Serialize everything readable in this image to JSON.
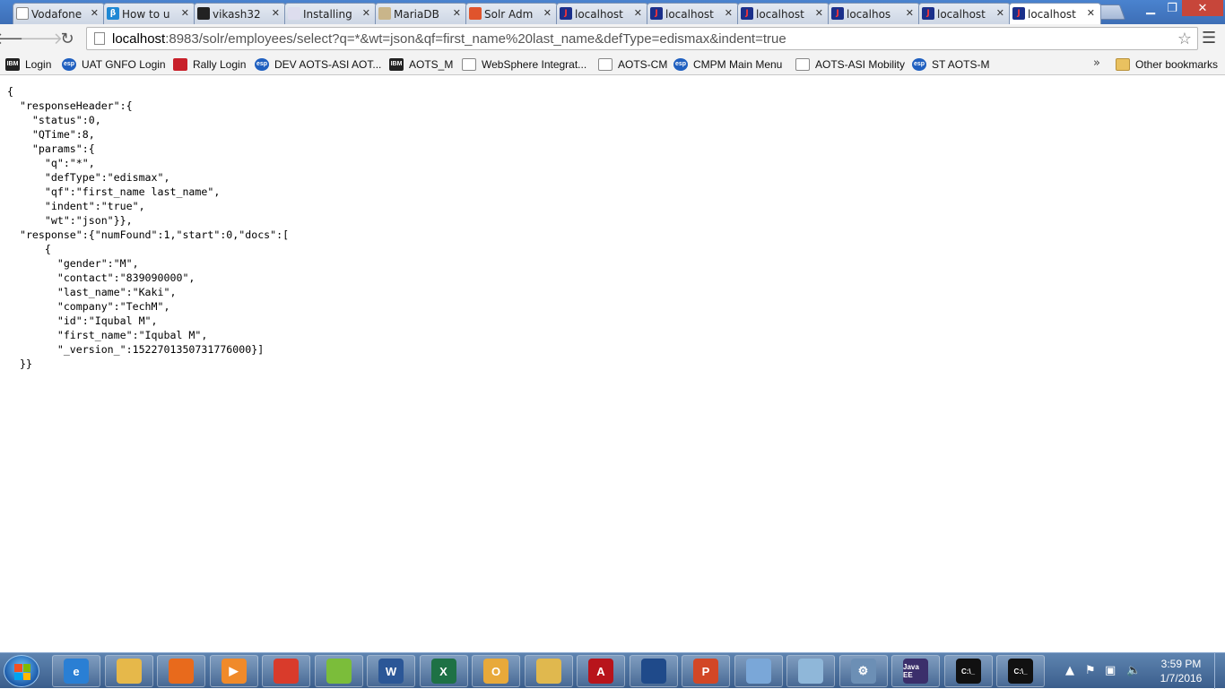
{
  "tabs": [
    {
      "title": "Vodafone",
      "icon": "document-icon"
    },
    {
      "title": "How to u",
      "icon": "blue-b-icon"
    },
    {
      "title": "vikash32",
      "icon": "github-icon"
    },
    {
      "title": "Installing",
      "icon": "installing-icon"
    },
    {
      "title": "MariaDB",
      "icon": "mariadb-icon"
    },
    {
      "title": "Solr Adm",
      "icon": "solr-icon"
    },
    {
      "title": "localhost",
      "icon": "jr-icon"
    },
    {
      "title": "localhost",
      "icon": "jr-icon"
    },
    {
      "title": "localhost",
      "icon": "jr-icon"
    },
    {
      "title": "localhos",
      "icon": "jr-icon"
    },
    {
      "title": "localhost",
      "icon": "jr-icon"
    },
    {
      "title": "localhost",
      "icon": "jr-icon",
      "active": true
    }
  ],
  "address_bar": {
    "host": "localhost",
    "rest": ":8983/solr/employees/select?q=*&wt=json&qf=first_name%20last_name&defType=edismax&indent=true"
  },
  "bookmarks": [
    {
      "label": "Login",
      "icon": "ibm"
    },
    {
      "label": "UAT GNFO Login",
      "icon": "esp"
    },
    {
      "label": "Rally Login",
      "icon": "rally"
    },
    {
      "label": "DEV AOTS-ASI AOT...",
      "icon": "esp"
    },
    {
      "label": "AOTS_M",
      "icon": "ibm"
    },
    {
      "label": "WebSphere Integrat...",
      "icon": "doc"
    },
    {
      "label": "AOTS-CM",
      "icon": "doc"
    },
    {
      "label": "CMPM Main Menu",
      "icon": "esp"
    },
    {
      "label": "AOTS-ASI Mobility",
      "icon": "doc"
    },
    {
      "label": "ST AOTS-M",
      "icon": "esp"
    }
  ],
  "other_bookmarks": "Other bookmarks",
  "json_lines": [
    "{",
    "  \"responseHeader\":{",
    "    \"status\":0,",
    "    \"QTime\":8,",
    "    \"params\":{",
    "      \"q\":\"*\",",
    "      \"defType\":\"edismax\",",
    "      \"qf\":\"first_name last_name\",",
    "      \"indent\":\"true\",",
    "      \"wt\":\"json\"}},",
    "  \"response\":{\"numFound\":1,\"start\":0,\"docs\":[",
    "      {",
    "        \"gender\":\"M\",",
    "        \"contact\":\"839090000\",",
    "        \"last_name\":\"Kaki\",",
    "        \"company\":\"TechM\",",
    "        \"id\":\"Iqubal M\",",
    "        \"first_name\":\"Iqubal M\",",
    "        \"_version_\":1522701350731776000}]",
    "  }}"
  ],
  "taskbar": {
    "apps": [
      {
        "name": "internet-explorer-icon",
        "color": "#2a7fd4",
        "glyph": "e"
      },
      {
        "name": "file-explorer-icon",
        "color": "#e6b84a",
        "glyph": ""
      },
      {
        "name": "firefox-icon",
        "color": "#e86a1c",
        "glyph": ""
      },
      {
        "name": "media-player-icon",
        "color": "#f08a2a",
        "glyph": "▶"
      },
      {
        "name": "chrome-icon",
        "color": "#d93b2b",
        "glyph": ""
      },
      {
        "name": "notepad-plus-icon",
        "color": "#7bbd3a",
        "glyph": ""
      },
      {
        "name": "word-icon",
        "color": "#2b5797",
        "glyph": "W"
      },
      {
        "name": "excel-icon",
        "color": "#1e7145",
        "glyph": "X"
      },
      {
        "name": "outlook-icon",
        "color": "#e8a93a",
        "glyph": "O"
      },
      {
        "name": "folder-tool-icon",
        "color": "#e0b84e",
        "glyph": ""
      },
      {
        "name": "acrobat-icon",
        "color": "#b8141b",
        "glyph": "A"
      },
      {
        "name": "virtualbox-icon",
        "color": "#1f4a8a",
        "glyph": ""
      },
      {
        "name": "powerpoint-icon",
        "color": "#d24726",
        "glyph": "P"
      },
      {
        "name": "paint-icon",
        "color": "#7aa7d8",
        "glyph": ""
      },
      {
        "name": "notebook-icon",
        "color": "#8fb7d9",
        "glyph": ""
      },
      {
        "name": "settings-gear-icon",
        "color": "#6c8fb5",
        "glyph": "⚙"
      },
      {
        "name": "eclipse-javaee-icon",
        "color": "#3b2f6b",
        "glyph": "Java EE"
      },
      {
        "name": "cmd-icon",
        "color": "#111111",
        "glyph": "C:\\_"
      },
      {
        "name": "cmd-icon",
        "color": "#111111",
        "glyph": "C:\\_"
      }
    ],
    "clock_time": "3:59 PM",
    "clock_date": "1/7/2016"
  }
}
